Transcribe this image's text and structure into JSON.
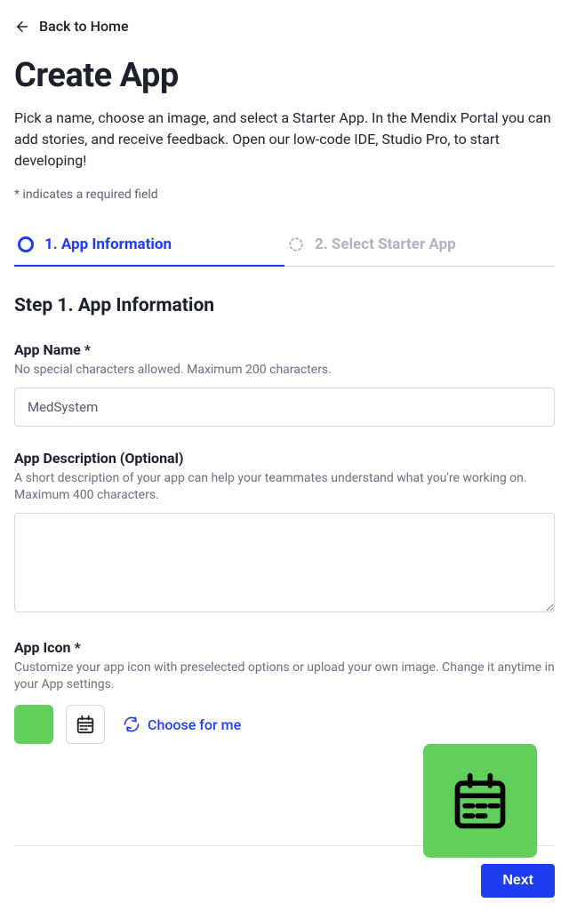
{
  "nav": {
    "back_label": "Back to Home"
  },
  "header": {
    "title": "Create App",
    "lead": "Pick a name, choose an image, and select a Starter App. In the Mendix Portal you can add stories, and receive feedback. Open our low-code IDE, Studio Pro, to start developing!",
    "required_note": "* indicates a required field"
  },
  "tabs": {
    "tab1_label": "1. App Information",
    "tab2_label": "2. Select Starter App"
  },
  "step": {
    "title": "Step 1. App Information"
  },
  "fields": {
    "name": {
      "label": "App Name *",
      "help": "No special characters allowed. Maximum 200 characters.",
      "value": "MedSystem"
    },
    "description": {
      "label": "App Description (Optional)",
      "help": "A short description of your app can help your teammates understand what you're working on. Maximum 400 characters.",
      "value": ""
    },
    "icon": {
      "label": "App Icon *",
      "help": "Customize your app icon with preselected options or upload your own image. Change it anytime in your App settings.",
      "choose_label": "Choose for me",
      "swatch_color": "#62ce5b"
    }
  },
  "footer": {
    "next_label": "Next"
  }
}
